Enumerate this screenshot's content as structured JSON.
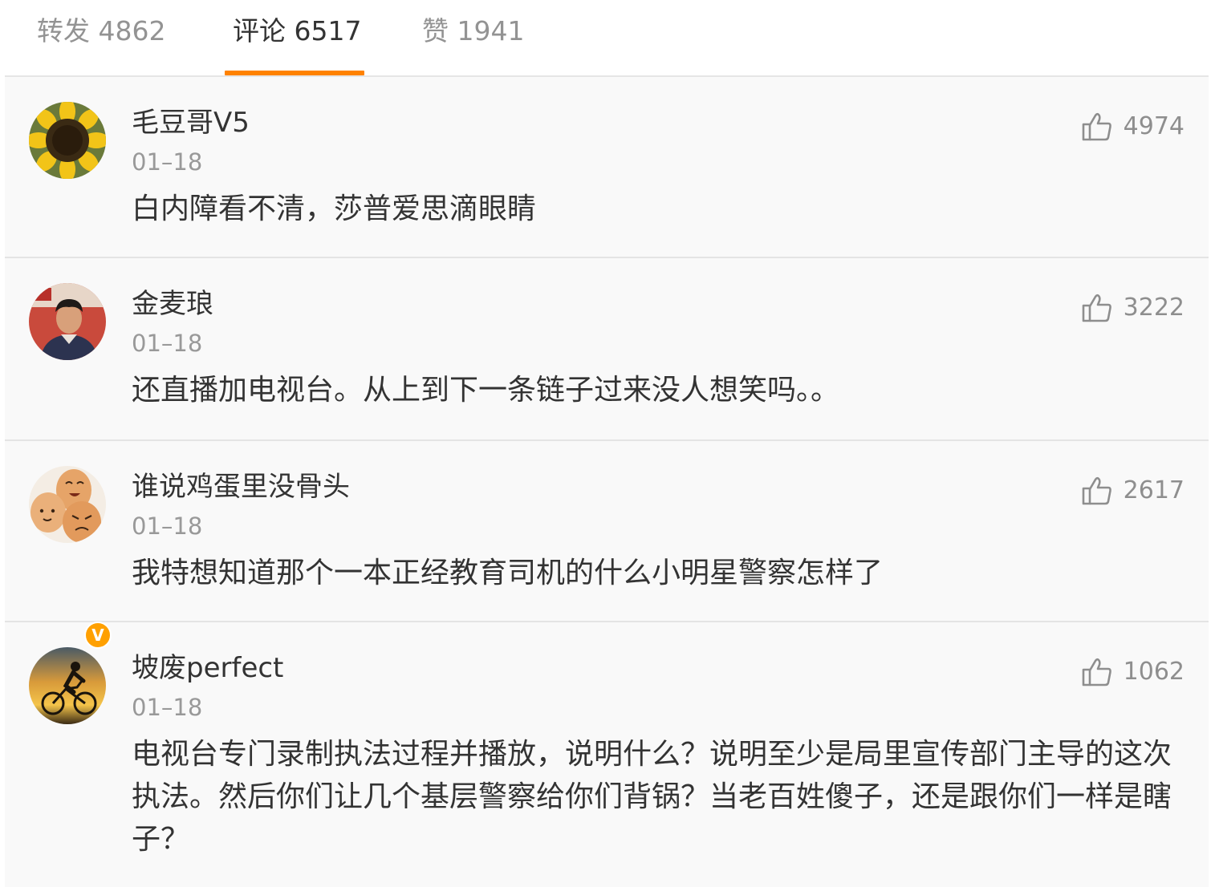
{
  "tabs": [
    {
      "label": "转发 4862"
    },
    {
      "label": "评论 6517"
    },
    {
      "label": "赞 1941"
    }
  ],
  "active_tab": "评论 6517",
  "accent_color": "#ff8200",
  "comments": [
    {
      "username": "毛豆哥V5",
      "time": "01–18",
      "text": "白内障看不清，莎普爱思滴眼睛",
      "likes": "4974",
      "avatar_icon": "sunflower-avatar"
    },
    {
      "username": "金麦琅",
      "time": "01–18",
      "text": "还直播加电视台。从上到下一条链子过来没人想笑吗。。",
      "likes": "3222",
      "avatar_icon": "person-photo-avatar"
    },
    {
      "username": "谁说鸡蛋里没骨头",
      "time": "01–18",
      "text": "我特想知道那个一本正经教育司机的什么小明星警察怎样了",
      "likes": "2617",
      "avatar_icon": "eggs-avatar"
    },
    {
      "username": "坡废perfect",
      "time": "01–18",
      "text": "电视台专门录制执法过程并播放，说明什么？说明至少是局里宣传部门主导的这次执法。然后你们让几个基层警察给你们背锅？当老百姓傻子，还是跟你们一样是瞎子？",
      "likes": "1062",
      "avatar_icon": "cyclist-sunset-avatar",
      "verified": "V"
    }
  ]
}
